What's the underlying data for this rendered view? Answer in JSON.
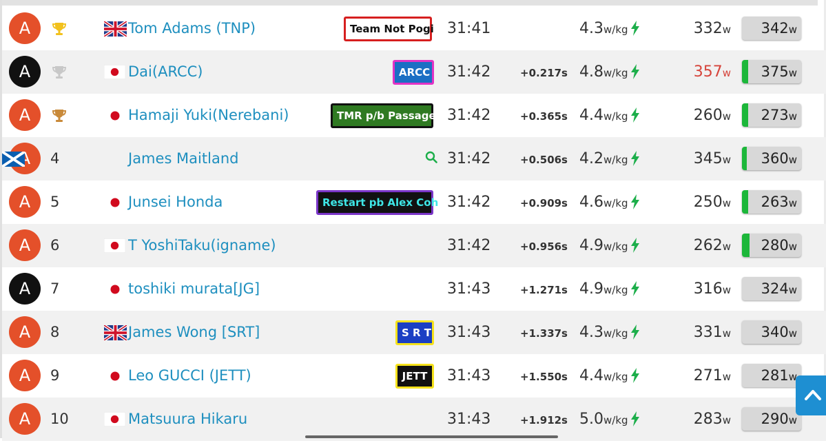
{
  "colors": {
    "accent_blue": "#1e8fbf",
    "category_orange": "#e4502a",
    "category_black": "#111111",
    "power_green": "#1cb73a",
    "highlight_red": "#d6443b",
    "bolt_green": "#1cae4a"
  },
  "units": {
    "wkg": "w/kg",
    "watts": "w"
  },
  "rows": [
    {
      "cat": "A",
      "cat_color": "orange",
      "pos": "",
      "trophy": "gold",
      "flag": "uk",
      "name": "Tom Adams (TNP)",
      "tag": {
        "text": "Team Not Pogi",
        "bg": "#ffffff",
        "border": "#d61f1f",
        "color": "#111111"
      },
      "time": "31:41",
      "gap": "",
      "wkg": "4.3",
      "avg": "332",
      "avg_red": false,
      "np": "342",
      "np_level": 0
    },
    {
      "cat": "A",
      "cat_color": "black",
      "pos": "",
      "trophy": "silver",
      "flag": "jp",
      "name": "Dai(ARCC)",
      "tag": {
        "text": "ARCC",
        "bg": "#1b6fc4",
        "border": "#e233c5",
        "color": "#ffffff"
      },
      "time": "31:42",
      "gap": "+0.217s",
      "wkg": "4.8",
      "avg": "357",
      "avg_red": true,
      "np": "375",
      "np_level": 0.1
    },
    {
      "cat": "A",
      "cat_color": "orange",
      "pos": "",
      "trophy": "bronze",
      "flag": "dot",
      "name": "Hamaji Yuki(Nerebani)",
      "tag": {
        "text": "TMR p/b Passage",
        "bg": "#2f7a22",
        "border": "#111111",
        "color": "#ffffff"
      },
      "time": "31:42",
      "gap": "+0.365s",
      "wkg": "4.4",
      "avg": "260",
      "avg_red": false,
      "np": "273",
      "np_level": 0.1
    },
    {
      "cat": "A",
      "cat_color": "orange",
      "pos": "4",
      "trophy": "",
      "flag": "scot",
      "name": "James Maitland",
      "tag": null,
      "search": true,
      "time": "31:42",
      "gap": "+0.506s",
      "wkg": "4.2",
      "avg": "345",
      "avg_red": false,
      "np": "360",
      "np_level": 0.08
    },
    {
      "cat": "A",
      "cat_color": "orange",
      "pos": "5",
      "trophy": "",
      "flag": "dot",
      "name": "Junsei Honda",
      "tag": {
        "text": "Restart pb Alex Coh",
        "bg": "#111111",
        "border": "#7a35c8",
        "color": "#3ee6e6"
      },
      "time": "31:42",
      "gap": "+0.909s",
      "wkg": "4.6",
      "avg": "250",
      "avg_red": false,
      "np": "263",
      "np_level": 0.1
    },
    {
      "cat": "A",
      "cat_color": "orange",
      "pos": "6",
      "trophy": "",
      "flag": "jp",
      "name": "T YoshiTaku(igname)",
      "tag": null,
      "time": "31:42",
      "gap": "+0.956s",
      "wkg": "4.9",
      "avg": "262",
      "avg_red": false,
      "np": "280",
      "np_level": 0.13
    },
    {
      "cat": "A",
      "cat_color": "black",
      "pos": "7",
      "trophy": "",
      "flag": "dot",
      "name": "toshiki murata[JG]",
      "tag": null,
      "time": "31:43",
      "gap": "+1.271s",
      "wkg": "4.9",
      "avg": "316",
      "avg_red": false,
      "np": "324",
      "np_level": 0
    },
    {
      "cat": "A",
      "cat_color": "orange",
      "pos": "8",
      "trophy": "",
      "flag": "uk",
      "name": "James Wong [SRT]",
      "tag": {
        "text": "S R T",
        "bg": "#1b3fc4",
        "border": "#f5e21c",
        "color": "#ffffff"
      },
      "time": "31:43",
      "gap": "+1.337s",
      "wkg": "4.3",
      "avg": "331",
      "avg_red": false,
      "np": "340",
      "np_level": 0
    },
    {
      "cat": "A",
      "cat_color": "orange",
      "pos": "9",
      "trophy": "",
      "flag": "dot",
      "name": "Leo GUCCI (JETT)",
      "tag": {
        "text": "JETT",
        "bg": "#111111",
        "border": "#f5e21c",
        "color": "#ffffff"
      },
      "time": "31:43",
      "gap": "+1.550s",
      "wkg": "4.4",
      "avg": "271",
      "avg_red": false,
      "np": "281",
      "np_level": 0
    },
    {
      "cat": "A",
      "cat_color": "orange",
      "pos": "10",
      "trophy": "",
      "flag": "jp",
      "name": "Matsuura Hikaru",
      "tag": null,
      "time": "31:43",
      "gap": "+1.912s",
      "wkg": "5.0",
      "avg": "283",
      "avg_red": false,
      "np": "290",
      "np_level": 0
    }
  ],
  "scroll_top_icon": "chevron-up-icon"
}
